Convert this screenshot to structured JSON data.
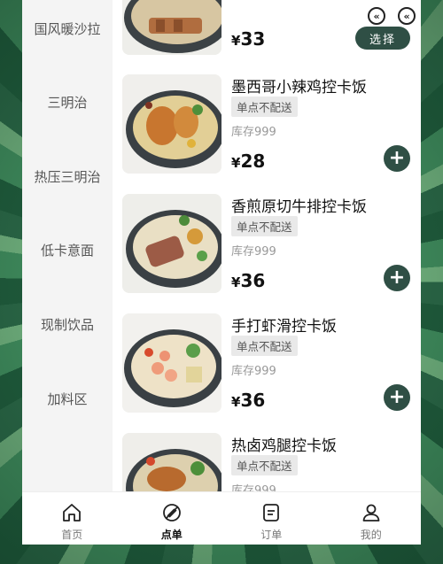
{
  "sidebar": {
    "categories": [
      "国风暖沙拉",
      "三明治",
      "热压三明治",
      "低卡意面",
      "现制饮品",
      "加料区"
    ]
  },
  "items": [
    {
      "name": "",
      "price": "33",
      "action": "选择"
    },
    {
      "name": "墨西哥小辣鸡控卡饭",
      "badge": "单点不配送",
      "stock": "库存999",
      "price": "28",
      "action": "+"
    },
    {
      "name": "香煎原切牛排控卡饭",
      "badge": "单点不配送",
      "stock": "库存999",
      "price": "36",
      "action": "+"
    },
    {
      "name": "手打虾滑控卡饭",
      "badge": "单点不配送",
      "stock": "库存999",
      "price": "36",
      "action": "+"
    },
    {
      "name": "热卤鸡腿控卡饭",
      "badge": "单点不配送",
      "stock": "库存999",
      "price": "",
      "action": ""
    }
  ],
  "currency": "¥",
  "tabbar": {
    "tabs": [
      {
        "label": "首页",
        "icon": "home-icon"
      },
      {
        "label": "点单",
        "icon": "order-food-icon",
        "active": true
      },
      {
        "label": "订单",
        "icon": "orders-icon"
      },
      {
        "label": "我的",
        "icon": "profile-icon"
      }
    ]
  },
  "colors": {
    "accent": "#2f4f45",
    "badge_bg": "#e9e9e9",
    "sidebar_bg": "#f4f4f4"
  }
}
